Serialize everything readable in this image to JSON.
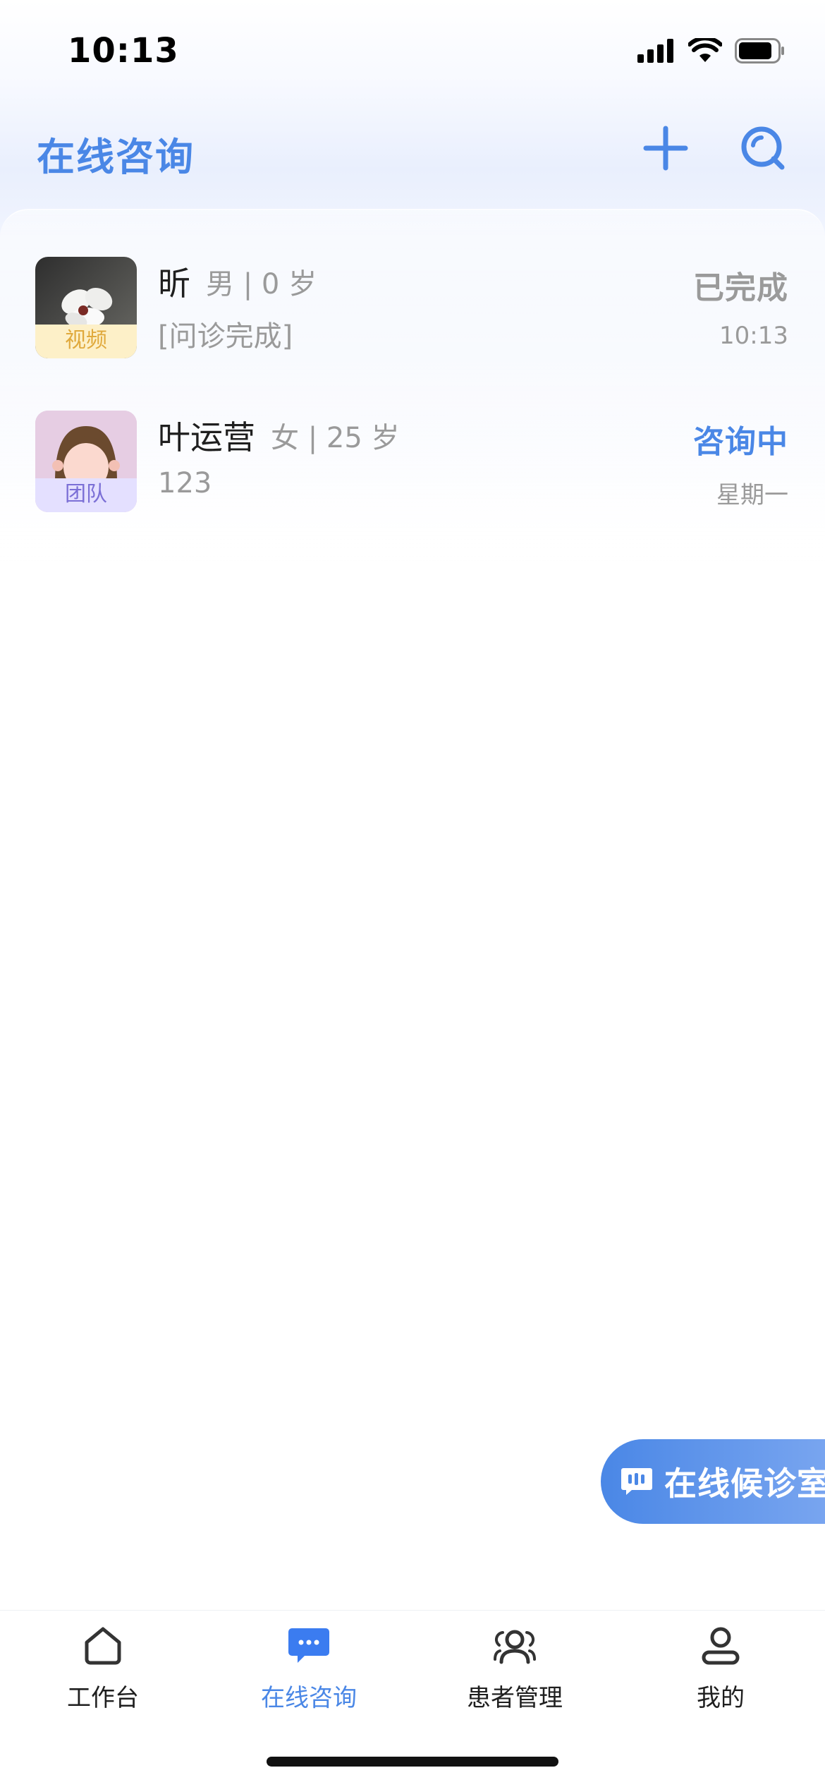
{
  "status_bar": {
    "time": "10:13",
    "icons": [
      "signal-icon",
      "wifi-icon",
      "battery-icon"
    ]
  },
  "header": {
    "title": "在线咨询",
    "icons": [
      "plus-icon",
      "search-icon"
    ]
  },
  "consultations": [
    {
      "name": "昕",
      "gender_age": "男 | 0 岁",
      "avatar_tag": "视频",
      "preview": "[问诊完成]",
      "status": "已完成",
      "time": "10:13"
    },
    {
      "name": "叶运营",
      "gender_age": "女 | 25 岁",
      "avatar_tag": "团队",
      "preview": "123",
      "status": "咨询中",
      "time": "星期一"
    }
  ],
  "fab": {
    "label": "在线候诊室",
    "icon": "chat-bubble-icon"
  },
  "tabs": [
    {
      "label": "工作台",
      "icon": "home-icon",
      "active": false
    },
    {
      "label": "在线咨询",
      "icon": "chat-icon",
      "active": true
    },
    {
      "label": "患者管理",
      "icon": "patients-icon",
      "active": false
    },
    {
      "label": "我的",
      "icon": "profile-icon",
      "active": false
    }
  ],
  "colors": {
    "accent": "#4a87e6",
    "status_done": "#9a9a9a",
    "status_active": "#4a87e6",
    "tag_video_bg": "#fdf0c8",
    "tag_video_text": "#e0a93c",
    "tag_team_bg": "#e4e0ff",
    "tag_team_text": "#7b6fd6"
  }
}
